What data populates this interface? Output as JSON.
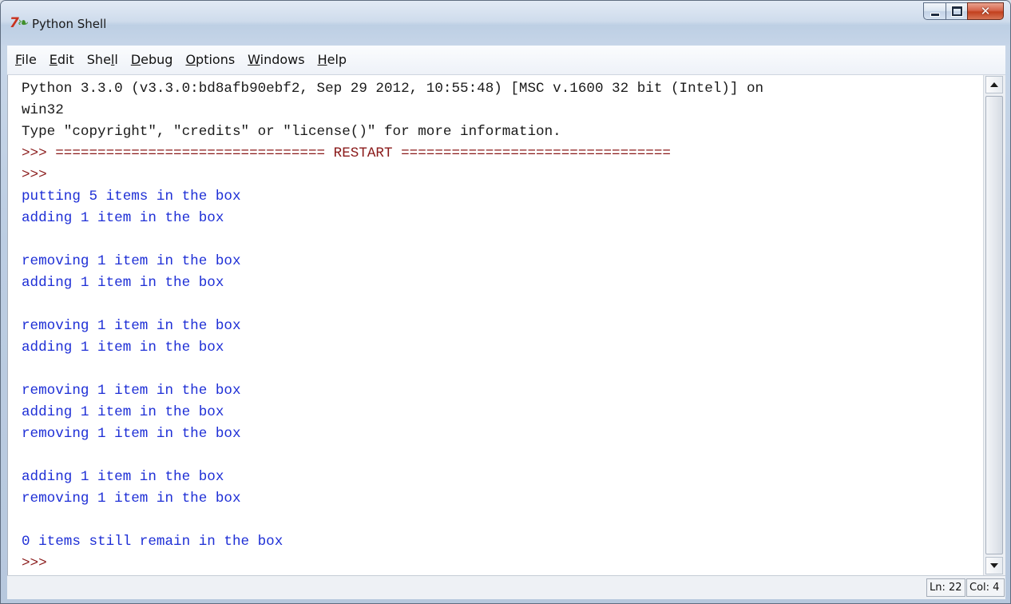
{
  "window": {
    "title": "Python Shell",
    "icon": "idle-python-icon",
    "caption_buttons": [
      "minimize-icon",
      "maximize-icon",
      "close-icon"
    ]
  },
  "menubar": {
    "items": [
      {
        "accel": "F",
        "rest": "ile"
      },
      {
        "accel": "E",
        "rest": "dit"
      },
      {
        "pre": "She",
        "accel": "l",
        "rest": "l"
      },
      {
        "accel": "D",
        "rest": "ebug"
      },
      {
        "accel": "O",
        "rest": "ptions"
      },
      {
        "accel": "W",
        "rest": "indows"
      },
      {
        "accel": "H",
        "rest": "elp"
      }
    ]
  },
  "shell": {
    "colors": {
      "output": "#1e2fd6",
      "text": "#1a1a1a",
      "prompt": "#8a1a1a"
    },
    "lines": [
      {
        "text": "Python 3.3.0 (v3.3.0:bd8afb90ebf2, Sep 29 2012, 10:55:48) [MSC v.1600 32 bit (Intel)] on",
        "style": "black"
      },
      {
        "text": "win32",
        "style": "black"
      },
      {
        "text": "Type \"copyright\", \"credits\" or \"license()\" for more information.",
        "style": "black"
      },
      {
        "text": ">>> ================================ RESTART ================================",
        "style": "prompt"
      },
      {
        "text": ">>> ",
        "style": "prompt"
      },
      {
        "text": "putting 5 items in the box",
        "style": "blue"
      },
      {
        "text": "adding 1 item in the box",
        "style": "blue"
      },
      {
        "text": "",
        "style": "blue"
      },
      {
        "text": "removing 1 item in the box",
        "style": "blue"
      },
      {
        "text": "adding 1 item in the box",
        "style": "blue"
      },
      {
        "text": "",
        "style": "blue"
      },
      {
        "text": "removing 1 item in the box",
        "style": "blue"
      },
      {
        "text": "adding 1 item in the box",
        "style": "blue"
      },
      {
        "text": "",
        "style": "blue"
      },
      {
        "text": "removing 1 item in the box",
        "style": "blue"
      },
      {
        "text": "adding 1 item in the box",
        "style": "blue"
      },
      {
        "text": "removing 1 item in the box",
        "style": "blue"
      },
      {
        "text": "",
        "style": "blue"
      },
      {
        "text": "adding 1 item in the box",
        "style": "blue"
      },
      {
        "text": "removing 1 item in the box",
        "style": "blue"
      },
      {
        "text": "",
        "style": "blue"
      },
      {
        "text": "0 items still remain in the box",
        "style": "blue"
      },
      {
        "text": ">>> ",
        "style": "prompt"
      }
    ]
  },
  "statusbar": {
    "ln": "Ln: 22",
    "col": "Col: 4"
  }
}
